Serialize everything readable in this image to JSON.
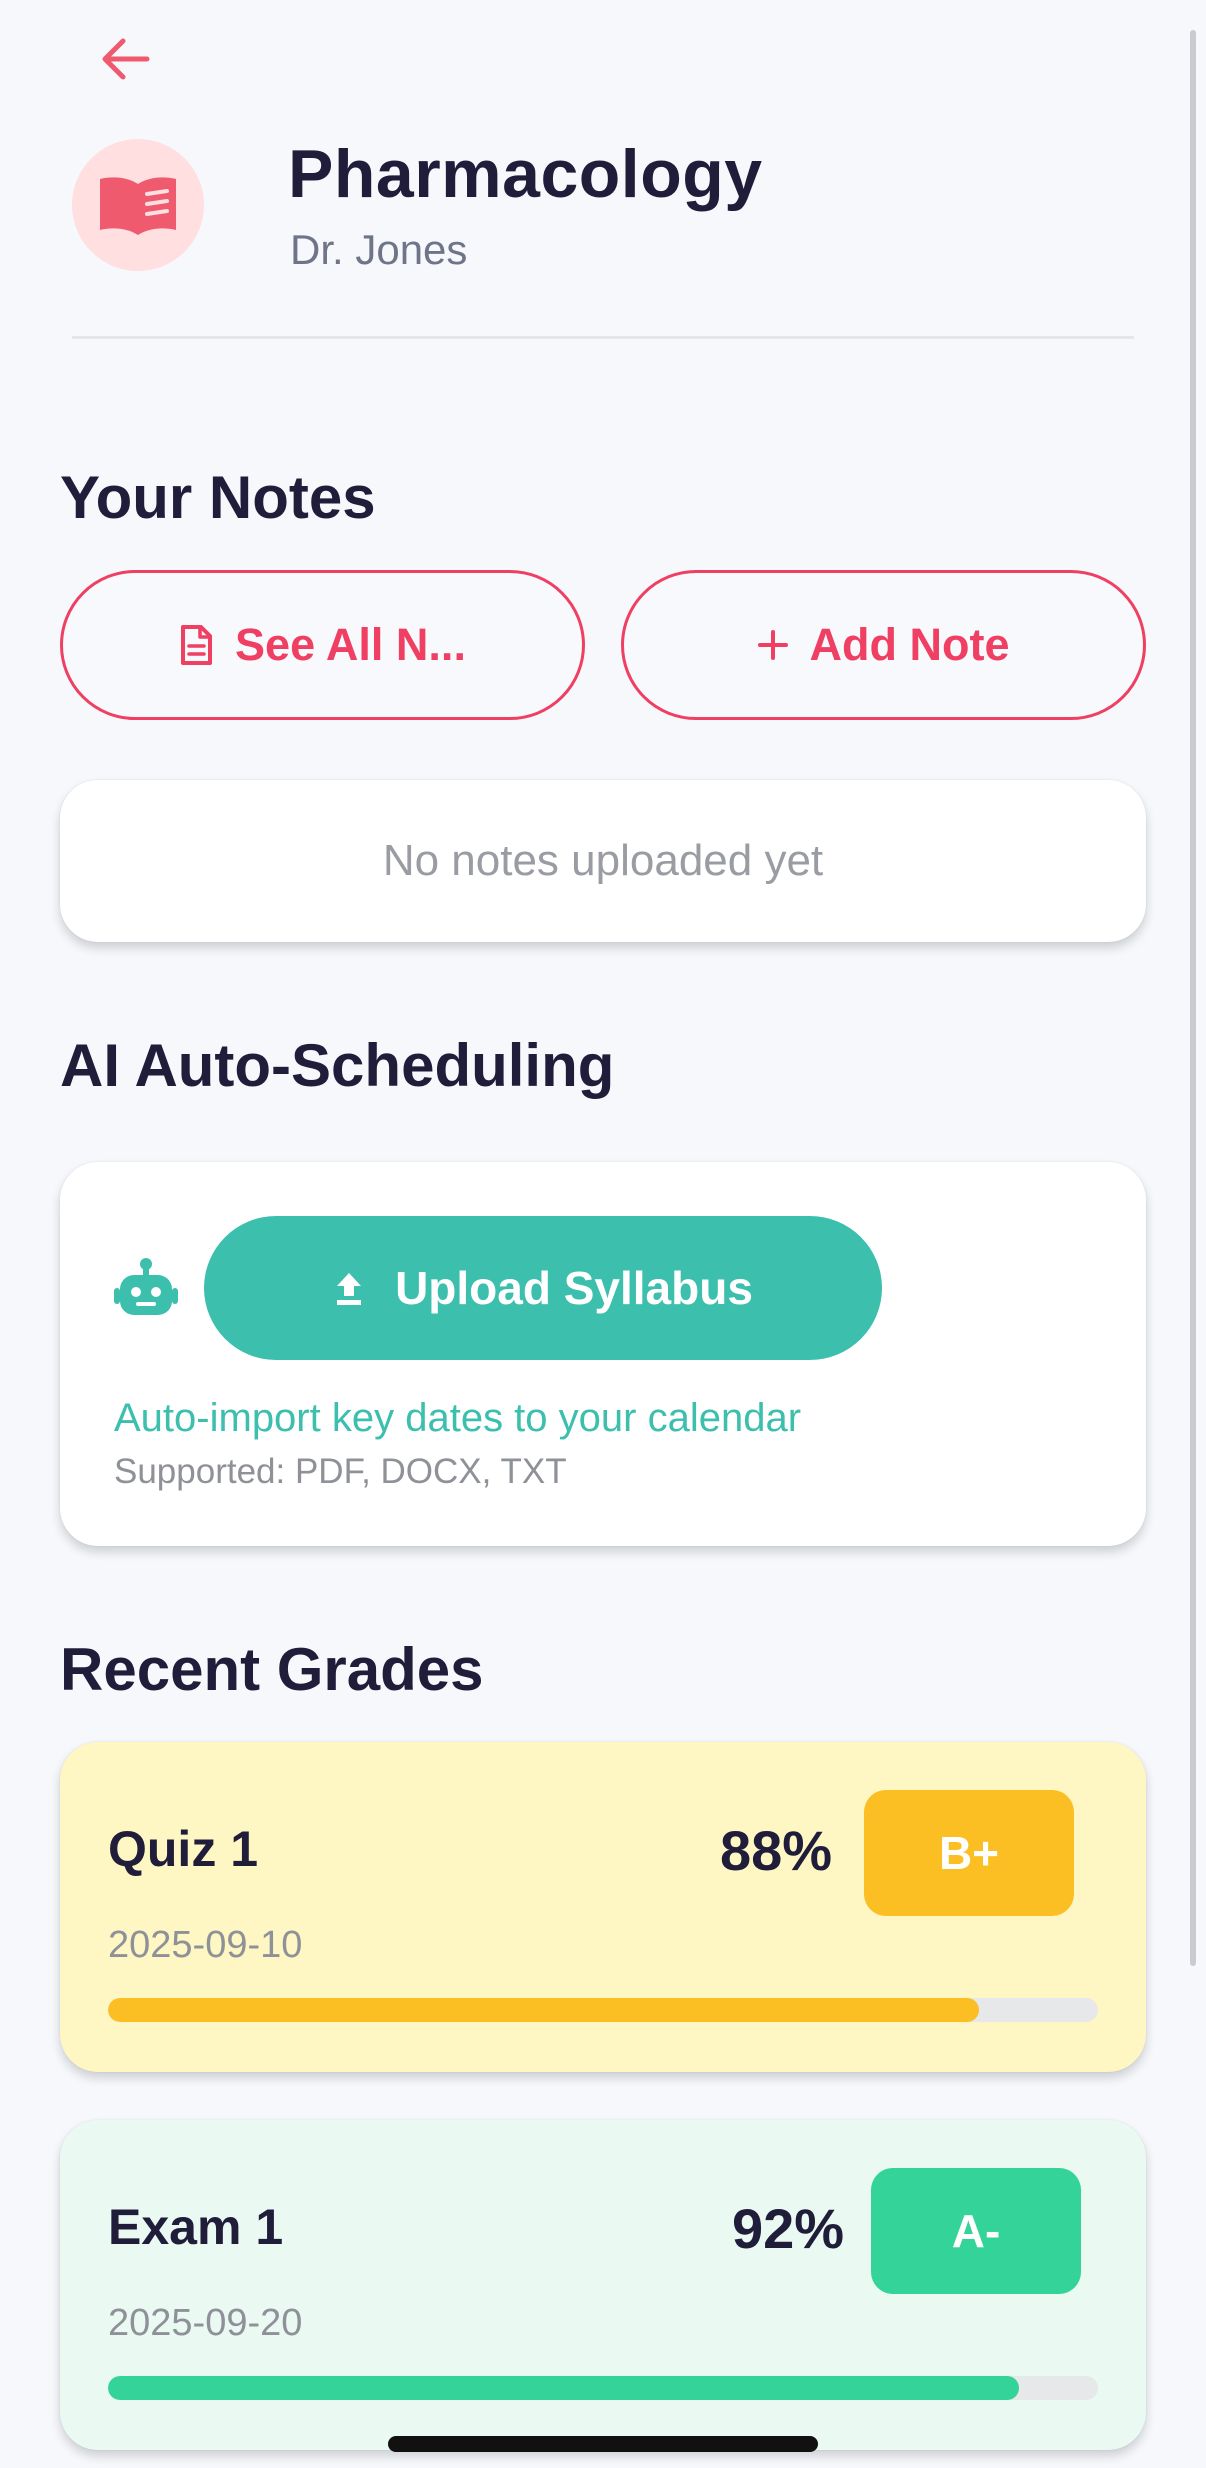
{
  "header": {
    "back_icon": "arrow-left-icon",
    "course_icon": "book-open-icon",
    "course_title": "Pharmacology",
    "instructor": "Dr. Jones"
  },
  "notes": {
    "section_title": "Your Notes",
    "see_all_label": "See All N...",
    "see_all_icon": "document-icon",
    "add_label": "Add Note",
    "add_icon": "plus-icon",
    "empty_text": "No notes uploaded yet"
  },
  "ai": {
    "section_title": "AI Auto-Scheduling",
    "robot_icon": "robot-icon",
    "upload_label": "Upload Syllabus",
    "upload_icon": "upload-icon",
    "description": "Auto-import key dates to your calendar",
    "supported": "Supported: PDF, DOCX, TXT"
  },
  "grades": {
    "section_title": "Recent Grades",
    "items": [
      {
        "name": "Quiz 1",
        "date": "2025-09-10",
        "percent": "88%",
        "value": 0.88,
        "letter": "B+",
        "card_color": "#fef7c3",
        "accent": "#fbbf24"
      },
      {
        "name": "Exam 1",
        "date": "2025-09-20",
        "percent": "92%",
        "value": 0.92,
        "letter": "A-",
        "card_color": "#eafaf2",
        "accent": "#34d399"
      }
    ]
  },
  "colors": {
    "accent_red": "#ef3f63",
    "teal": "#3dbfae",
    "background": "#f6f8fb"
  }
}
